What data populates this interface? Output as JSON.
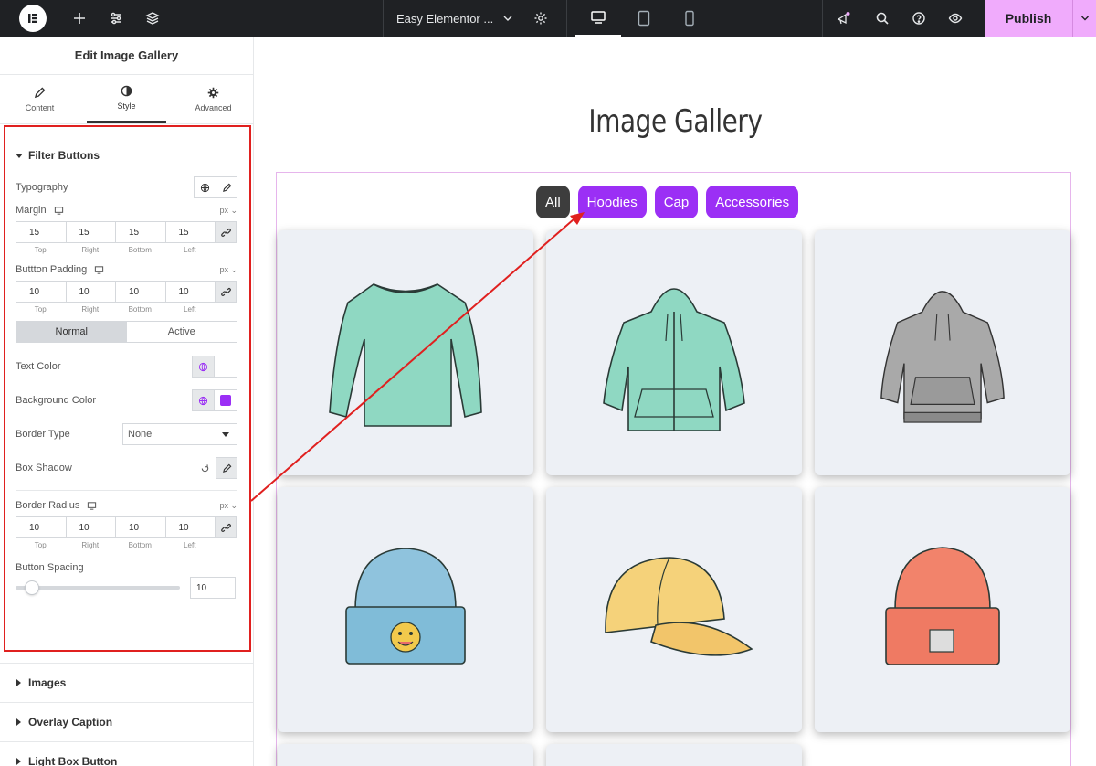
{
  "topbar": {
    "site_name": "Easy Elementor ...",
    "publish_label": "Publish",
    "accent": "#f0abfc"
  },
  "panel": {
    "title": "Edit Image Gallery",
    "tabs": [
      {
        "label": "Content",
        "icon": "pencil-icon"
      },
      {
        "label": "Style",
        "icon": "contrast-icon"
      },
      {
        "label": "Advanced",
        "icon": "gear-icon"
      }
    ],
    "section": {
      "title": "Filter Buttons",
      "typography_label": "Typography",
      "margin": {
        "label": "Margin",
        "unit": "px",
        "values": [
          "15",
          "15",
          "15",
          "15"
        ]
      },
      "padding": {
        "label": "Buttton Padding",
        "unit": "px",
        "values": [
          "10",
          "10",
          "10",
          "10"
        ]
      },
      "dim_labels": [
        "Top",
        "Right",
        "Bottom",
        "Left"
      ],
      "state_tabs": {
        "normal": "Normal",
        "active": "Active"
      },
      "text_color_label": "Text Color",
      "bg_color_label": "Background Color",
      "bg_color": "#9b2ff5",
      "border_type": {
        "label": "Border Type",
        "value": "None"
      },
      "box_shadow_label": "Box Shadow",
      "border_radius": {
        "label": "Border Radius",
        "unit": "px",
        "values": [
          "10",
          "10",
          "10",
          "10"
        ]
      },
      "spacing": {
        "label": "Button Spacing",
        "value": "10"
      }
    },
    "collapsed_sections": [
      "Images",
      "Overlay Caption",
      "Light Box Button"
    ]
  },
  "canvas": {
    "title": "Image Gallery",
    "filters": [
      "All",
      "Hoodies",
      "Cap",
      "Accessories"
    ],
    "filter_active_color": "#3d3d3d",
    "filter_color": "#9b2ff5",
    "items": [
      "long-sleeve-shirt",
      "zip-hoodie",
      "gray-hoodie",
      "blue-beanie",
      "yellow-cap",
      "red-beanie"
    ]
  }
}
